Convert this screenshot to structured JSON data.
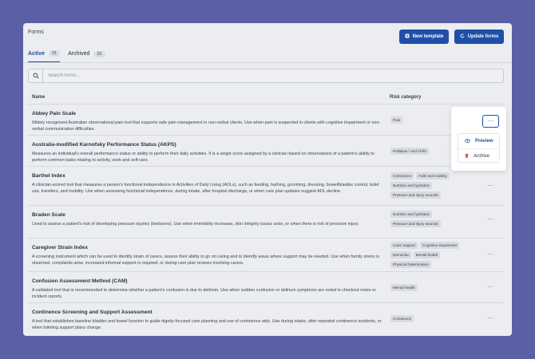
{
  "header": {
    "title": "Forms",
    "new_template_label": "New template",
    "update_forms_label": "Update forms"
  },
  "tabs": [
    {
      "label": "Active",
      "count": "31"
    },
    {
      "label": "Archived",
      "count": "22"
    }
  ],
  "search": {
    "placeholder": "Search forms..."
  },
  "table": {
    "col_name": "Name",
    "col_risk": "Risk category",
    "rows": [
      {
        "title": "Abbey Pain Scale",
        "desc": "Widely recognised Australian observational pain tool that supports safe pain management in non-verbal clients. Use when pain is suspected in clients with cognitive impairment or non-verbal communication difficulties.",
        "tags": [
          "Pain"
        ]
      },
      {
        "title": "Australia-modified Karnofsky Performance Status (AKPS)",
        "desc": "Measures an individual's overall performance status or ability to perform their daily activities. It is a single score assigned by a clinician based on observations of a patient's ability to perform common tasks relating to activity, work and self-care.",
        "tags": [
          "Palliative / end of life"
        ]
      },
      {
        "title": "Barthel Index",
        "desc": "A clinician-scored tool that measures a person's functional independence in Activities of Daily Living (ADLs), such as feeding, bathing, grooming, dressing, bowel/bladder control, toilet use, transfers, and mobility. Use when assessing functional independence, during intake, after hospital discharge, or when care plan updates suggest ADL decline.",
        "tags": [
          "Continence",
          "Falls and mobility",
          "Nutrition and hydration",
          "Pressure and injury wounds"
        ]
      },
      {
        "title": "Braden Scale",
        "desc": "Used to assess a patient's risk of developing pressure injuries (bedsores). Use when immobility increases, skin integrity issues arise, or when there is risk of pressure injury.",
        "tags": [
          "Nutrition and hydration",
          "Pressure and injury wounds"
        ]
      },
      {
        "title": "Caregiver Strain Index",
        "desc": "A screening instrument which can be used to identify strain of carers, assess their ability to go on caring and to identify areas where support may be needed. Use when family stress is observed, complaints arise, increased informal support is required, or during care plan reviews involving carers.",
        "tags": [
          "Carer support",
          "Cognitive impairment",
          "Dementia",
          "Mental health",
          "Physical Deterioration"
        ]
      },
      {
        "title": "Confusion Assessment Method (CAM)",
        "desc": "A validated tool that is recommended to determine whether a patient's confusion is due to delirium. Use when sudden confusion or delirium symptoms are noted in checkout notes or incident reports.",
        "tags": [
          "Mental health"
        ]
      },
      {
        "title": "Continence Screening and Support Assessment",
        "desc": "A tool that establishes baseline bladder and bowel function to guide dignity-focused care planning and use of continence aids. Use during intake, after repeated continence incidents, or when toileting support plans change.",
        "tags": [
          "Continence"
        ]
      }
    ]
  },
  "menu": {
    "preview_label": "Preview",
    "archive_label": "Archive"
  },
  "colors": {
    "accent": "#1f4fa8",
    "background": "#5a5fa6",
    "danger": "#d9534f"
  }
}
